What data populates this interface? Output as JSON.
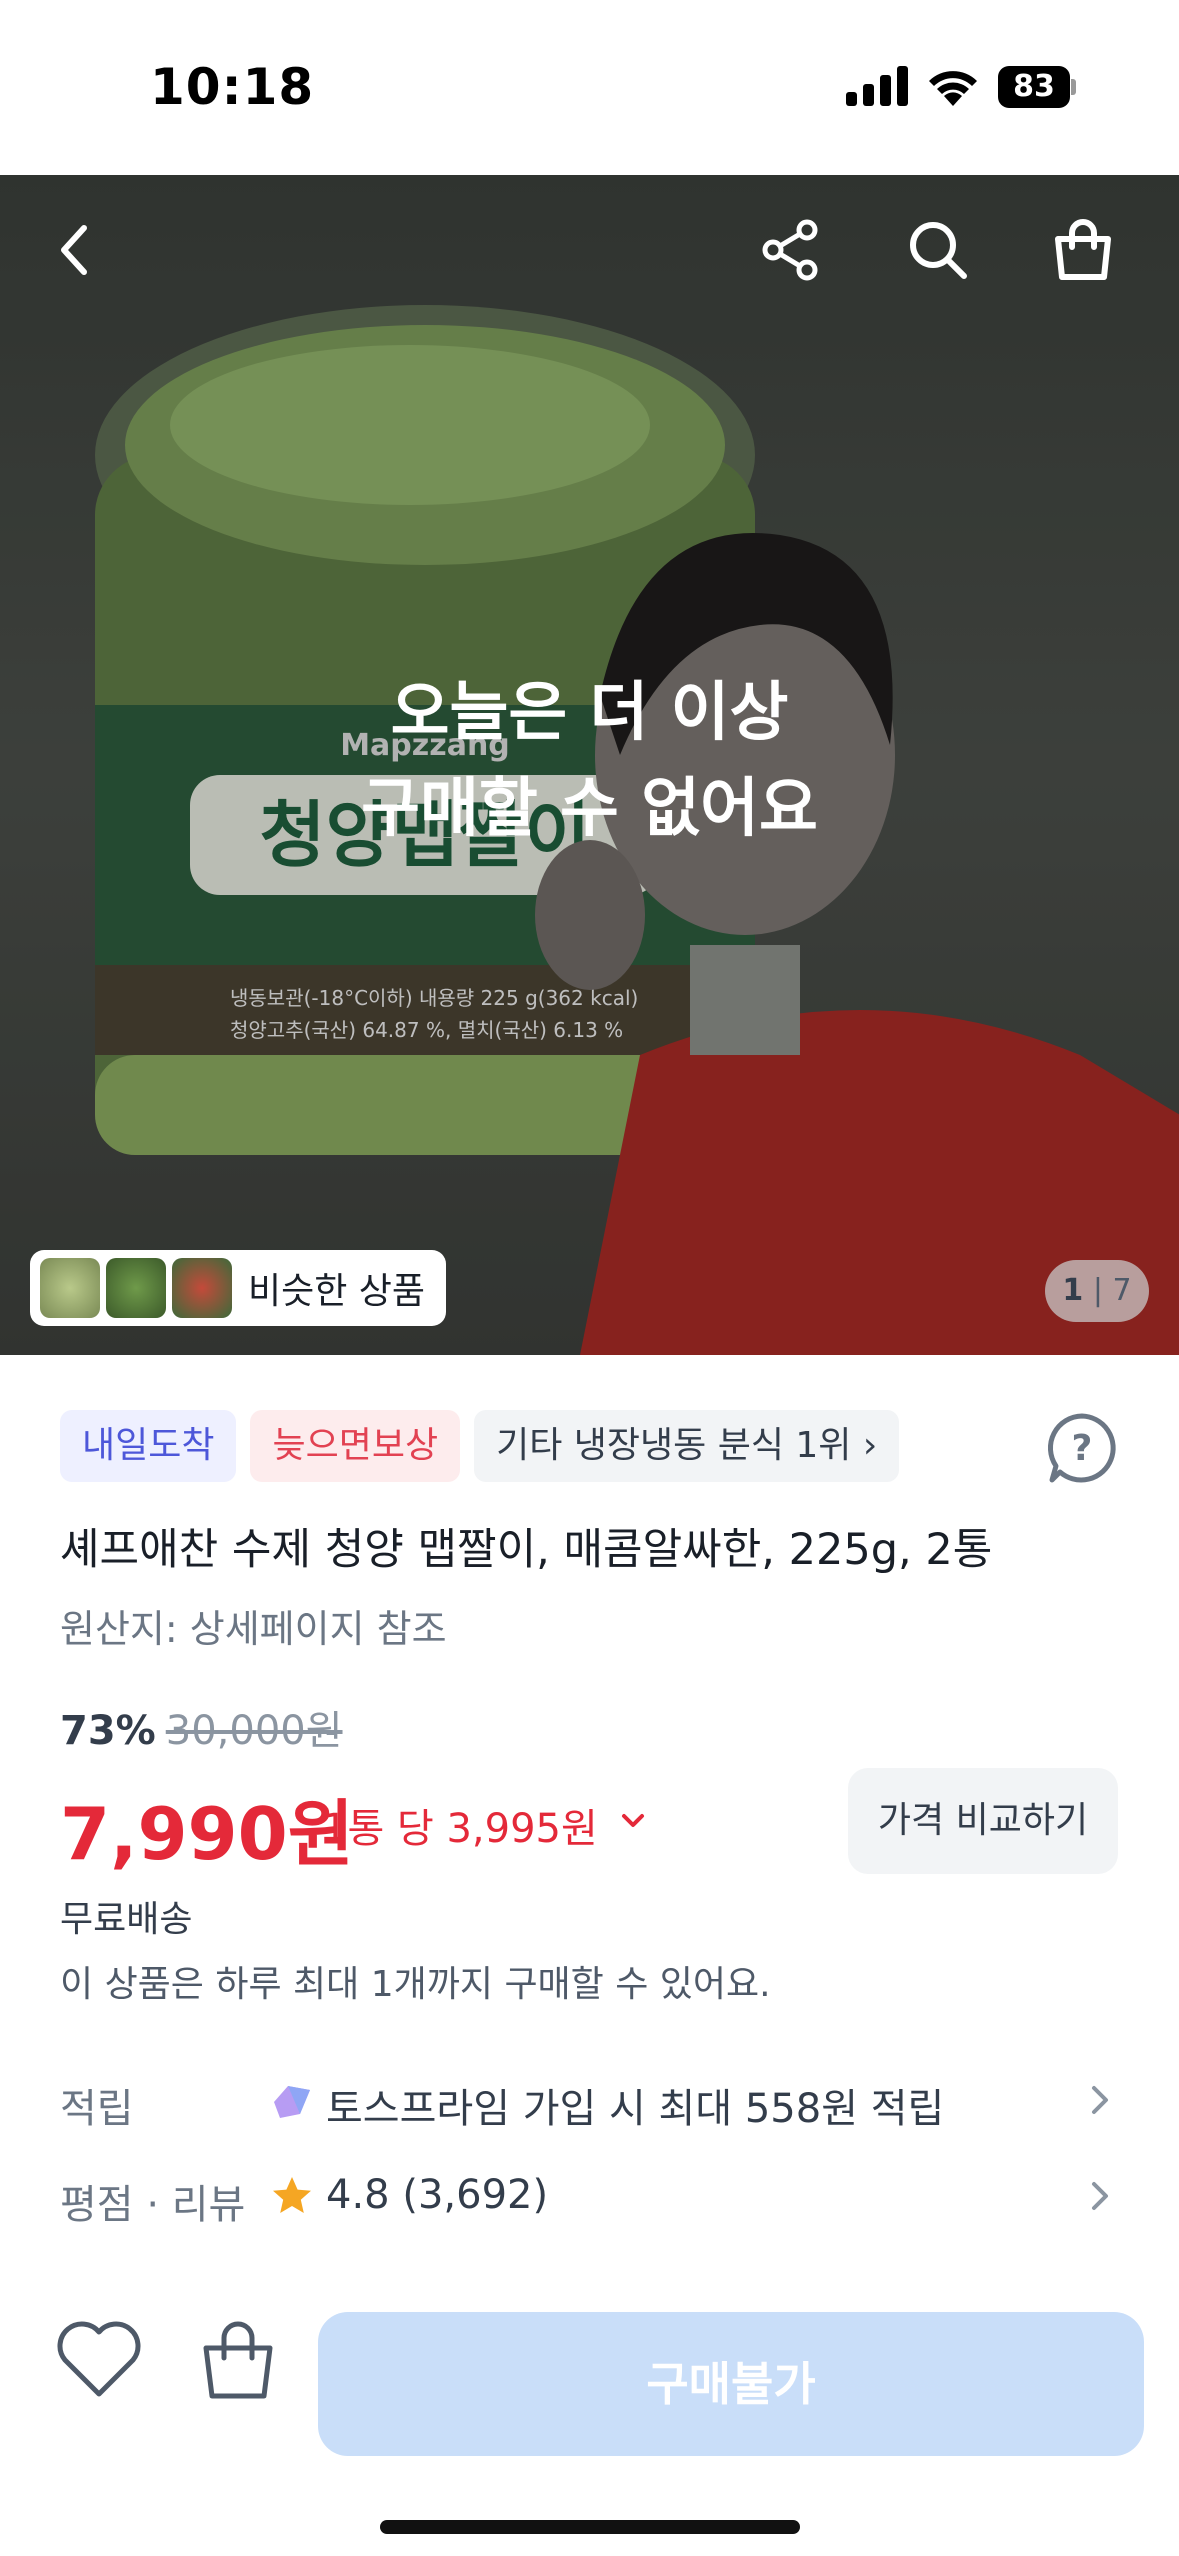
{
  "status_bar": {
    "time": "10:18",
    "battery": "83"
  },
  "hero": {
    "message_line1": "오늘은 더 이상",
    "message_line2": "구매할 수 없어요",
    "jar_label": "청양맵짤이",
    "jar_brand": "Mapzzang",
    "jar_small_text1": "냉동보관(-18°C이하)  내용량 225 g(362 kcal)",
    "jar_small_text2": "청양고추(국산) 64.87 %, 멸치(국산) 6.13 %",
    "similar_label": "비슷한 상품",
    "pager_current": "1",
    "pager_total": "7"
  },
  "tags": [
    {
      "label": "내일도착"
    },
    {
      "label": "늦으면보상"
    },
    {
      "label": "기타 냉장냉동 분식 1위 ›"
    }
  ],
  "product": {
    "title": "셰프애찬 수제 청양 맵짤이, 매콤알싸한, 225g, 2통",
    "origin": "원산지: 상세페이지 참조",
    "discount_pct": "73%",
    "original_price": "30,000원",
    "price": "7,990원",
    "unit_price": "1통 당 3,995원",
    "compare_label": "가격 비교하기",
    "shipping": "무료배송",
    "limit": "이 상품은 하루 최대 1개까지 구매할 수 있어요."
  },
  "rows": {
    "points_label": "적립",
    "points_text": "토스프라임 가입 시 최대 558원 적립",
    "review_label": "평점 · 리뷰",
    "rating": "4.8",
    "review_count": "(3,692)"
  },
  "bottom": {
    "buy_label": "구매불가"
  },
  "colors": {
    "accent_red": "#e42939",
    "disabled_blue": "#c9def9",
    "tag_blue": "#4d57d9",
    "star": "#f5a623"
  }
}
